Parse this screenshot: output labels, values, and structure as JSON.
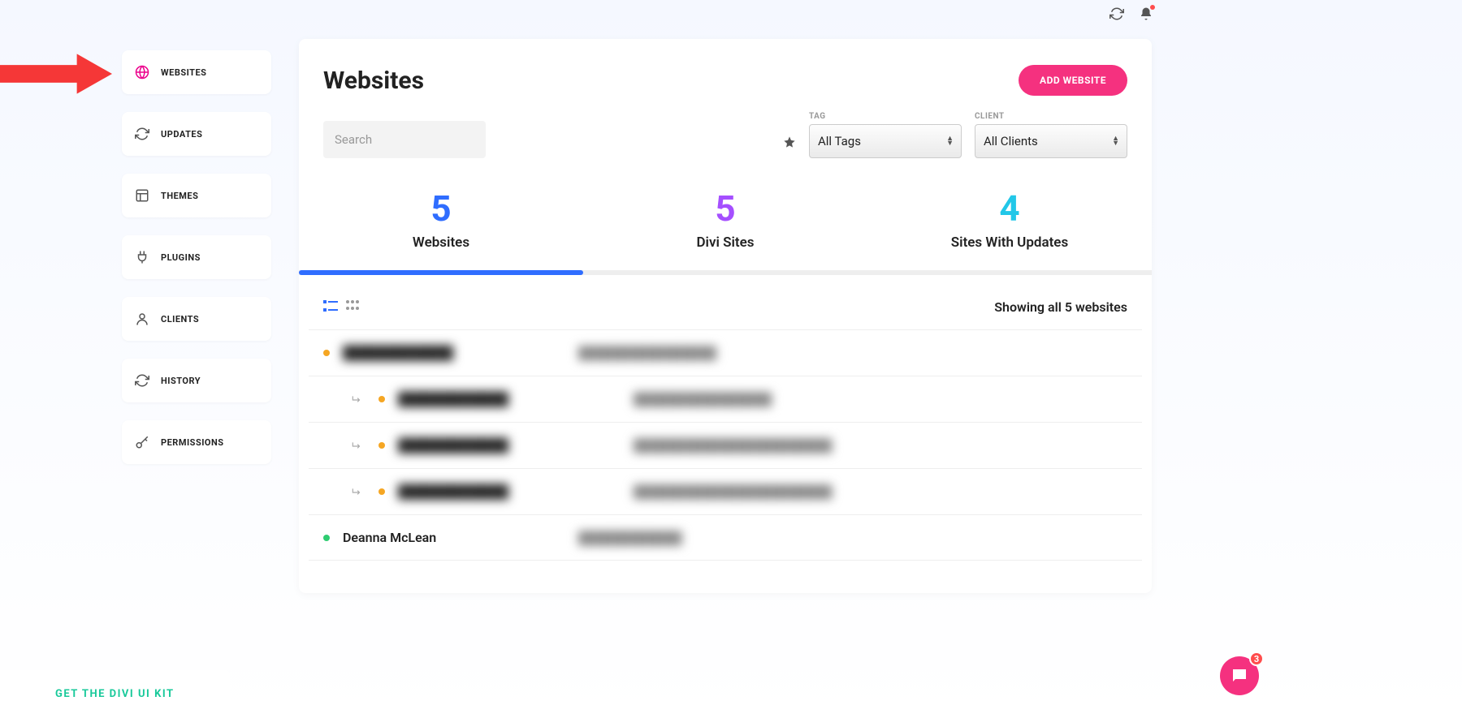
{
  "top": {
    "notif_count": 1
  },
  "sidebar": {
    "items": [
      {
        "label": "WEBSITES"
      },
      {
        "label": "UPDATES"
      },
      {
        "label": "THEMES"
      },
      {
        "label": "PLUGINS"
      },
      {
        "label": "CLIENTS"
      },
      {
        "label": "HISTORY"
      },
      {
        "label": "PERMISSIONS"
      }
    ]
  },
  "page": {
    "title": "Websites",
    "add_button": "ADD WEBSITE",
    "search_placeholder": "Search",
    "filter_tag_label": "TAG",
    "filter_tag_value": "All Tags",
    "filter_client_label": "CLIENT",
    "filter_client_value": "All Clients"
  },
  "stats": [
    {
      "value": "5",
      "label": "Websites"
    },
    {
      "value": "5",
      "label": "Divi Sites"
    },
    {
      "value": "4",
      "label": "Sites With Updates"
    }
  ],
  "list": {
    "showing": "Showing all 5 websites",
    "rows": [
      {
        "indent": false,
        "status": "orange",
        "name": "████████████",
        "url": "████████████████",
        "blurred": true
      },
      {
        "indent": true,
        "status": "orange",
        "name": "████████████",
        "url": "████████████████",
        "blurred": true
      },
      {
        "indent": true,
        "status": "orange",
        "name": "████████████",
        "url": "███████████████████████",
        "blurred": true
      },
      {
        "indent": true,
        "status": "orange",
        "name": "████████████",
        "url": "███████████████████████",
        "blurred": true
      },
      {
        "indent": false,
        "status": "green",
        "name": "Deanna McLean",
        "url": "████████████",
        "blurred_url_only": true
      }
    ]
  },
  "cta": {
    "label": "GET THE DIVI UI KIT"
  },
  "chat": {
    "badge": "3"
  }
}
